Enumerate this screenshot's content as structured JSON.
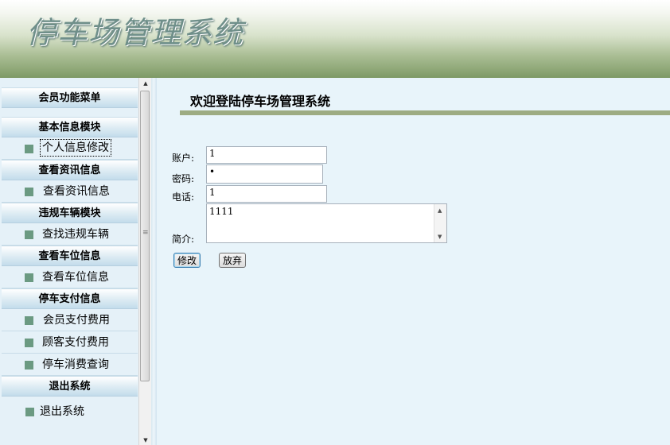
{
  "header": {
    "title": "停车场管理系统"
  },
  "sidebar": {
    "menu_title": "会员功能菜单",
    "sections": [
      {
        "title": "基本信息模块",
        "items": [
          "个人信息修改"
        ]
      },
      {
        "title": "查看资讯信息",
        "items": [
          "查看资讯信息"
        ]
      },
      {
        "title": "违规车辆模块",
        "items": [
          "查找违规车辆"
        ]
      },
      {
        "title": "查看车位信息",
        "items": [
          "查看车位信息"
        ]
      },
      {
        "title": "停车支付信息",
        "items": [
          "会员支付费用",
          "顾客支付费用",
          "停车消费查询"
        ]
      },
      {
        "title": "退出系统",
        "items": [
          "退出系统"
        ]
      }
    ],
    "icons": {
      "menu_item": "square-bullet-icon"
    }
  },
  "main": {
    "welcome": "欢迎登陆停车场管理系统",
    "form": {
      "account_label": "账户:",
      "account_value": "1",
      "password_label": "密码:",
      "password_value": "•",
      "phone_label": "电话:",
      "phone_value": "1",
      "intro_label": "简介:",
      "intro_value": "1111",
      "modify_button": "修改",
      "cancel_button": "放弃"
    }
  },
  "colors": {
    "header_gradient_bottom": "#7e9a66",
    "welcome_bar": "#9dab82",
    "bullet": "#6b9a82",
    "background": "#e8f4fa"
  }
}
